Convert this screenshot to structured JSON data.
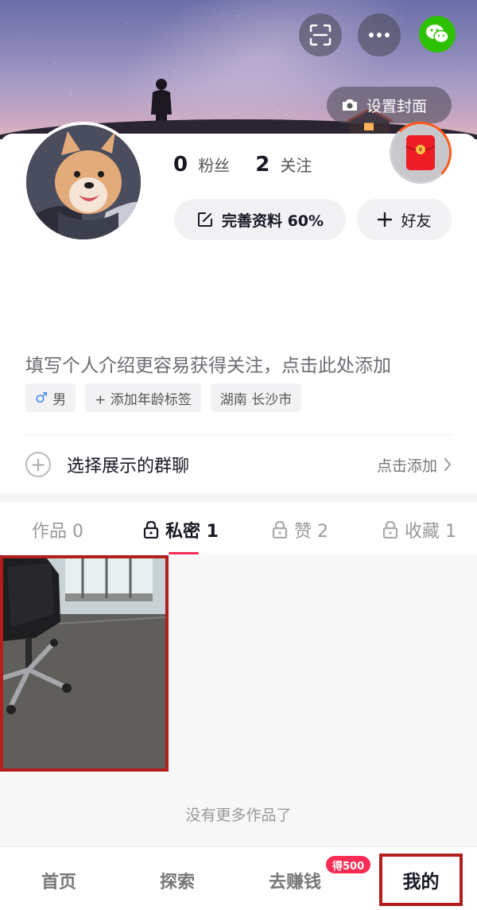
{
  "header": {
    "scan_icon": "scan-icon",
    "more_icon": "more-icon",
    "wechat_icon": "wechat-icon",
    "set_cover_label": "设置封面"
  },
  "profile": {
    "fans_count": "0",
    "fans_label": "粉丝",
    "following_count": "2",
    "following_label": "关注",
    "edit_profile_label": "完善资料 60%",
    "edit_profile_progress": 0.6,
    "add_friend_label": "好友",
    "bio_placeholder": "填写个人介绍更容易获得关注，点击此处添加",
    "tags": {
      "gender_symbol": "♂",
      "gender": "男",
      "add_age": "+ 添加年龄标签",
      "location": "湖南 长沙市"
    },
    "group_chat_label": "选择展示的群聊",
    "group_chat_action": "点击添加"
  },
  "tabs": [
    {
      "label": "作品 0",
      "locked": false
    },
    {
      "label": "私密 1",
      "locked": true,
      "active": true
    },
    {
      "label": "赞 2",
      "locked": true
    },
    {
      "label": "收藏 1",
      "locked": true
    }
  ],
  "grid": {
    "no_more_text": "没有更多作品了"
  },
  "nav": {
    "home": "首页",
    "explore": "探索",
    "earn": "去赚钱",
    "earn_badge": "得500",
    "me": "我的"
  },
  "colors": {
    "accent": "#fe2c55",
    "highlight_border": "#b21e1e",
    "wechat": "#2dc100"
  }
}
